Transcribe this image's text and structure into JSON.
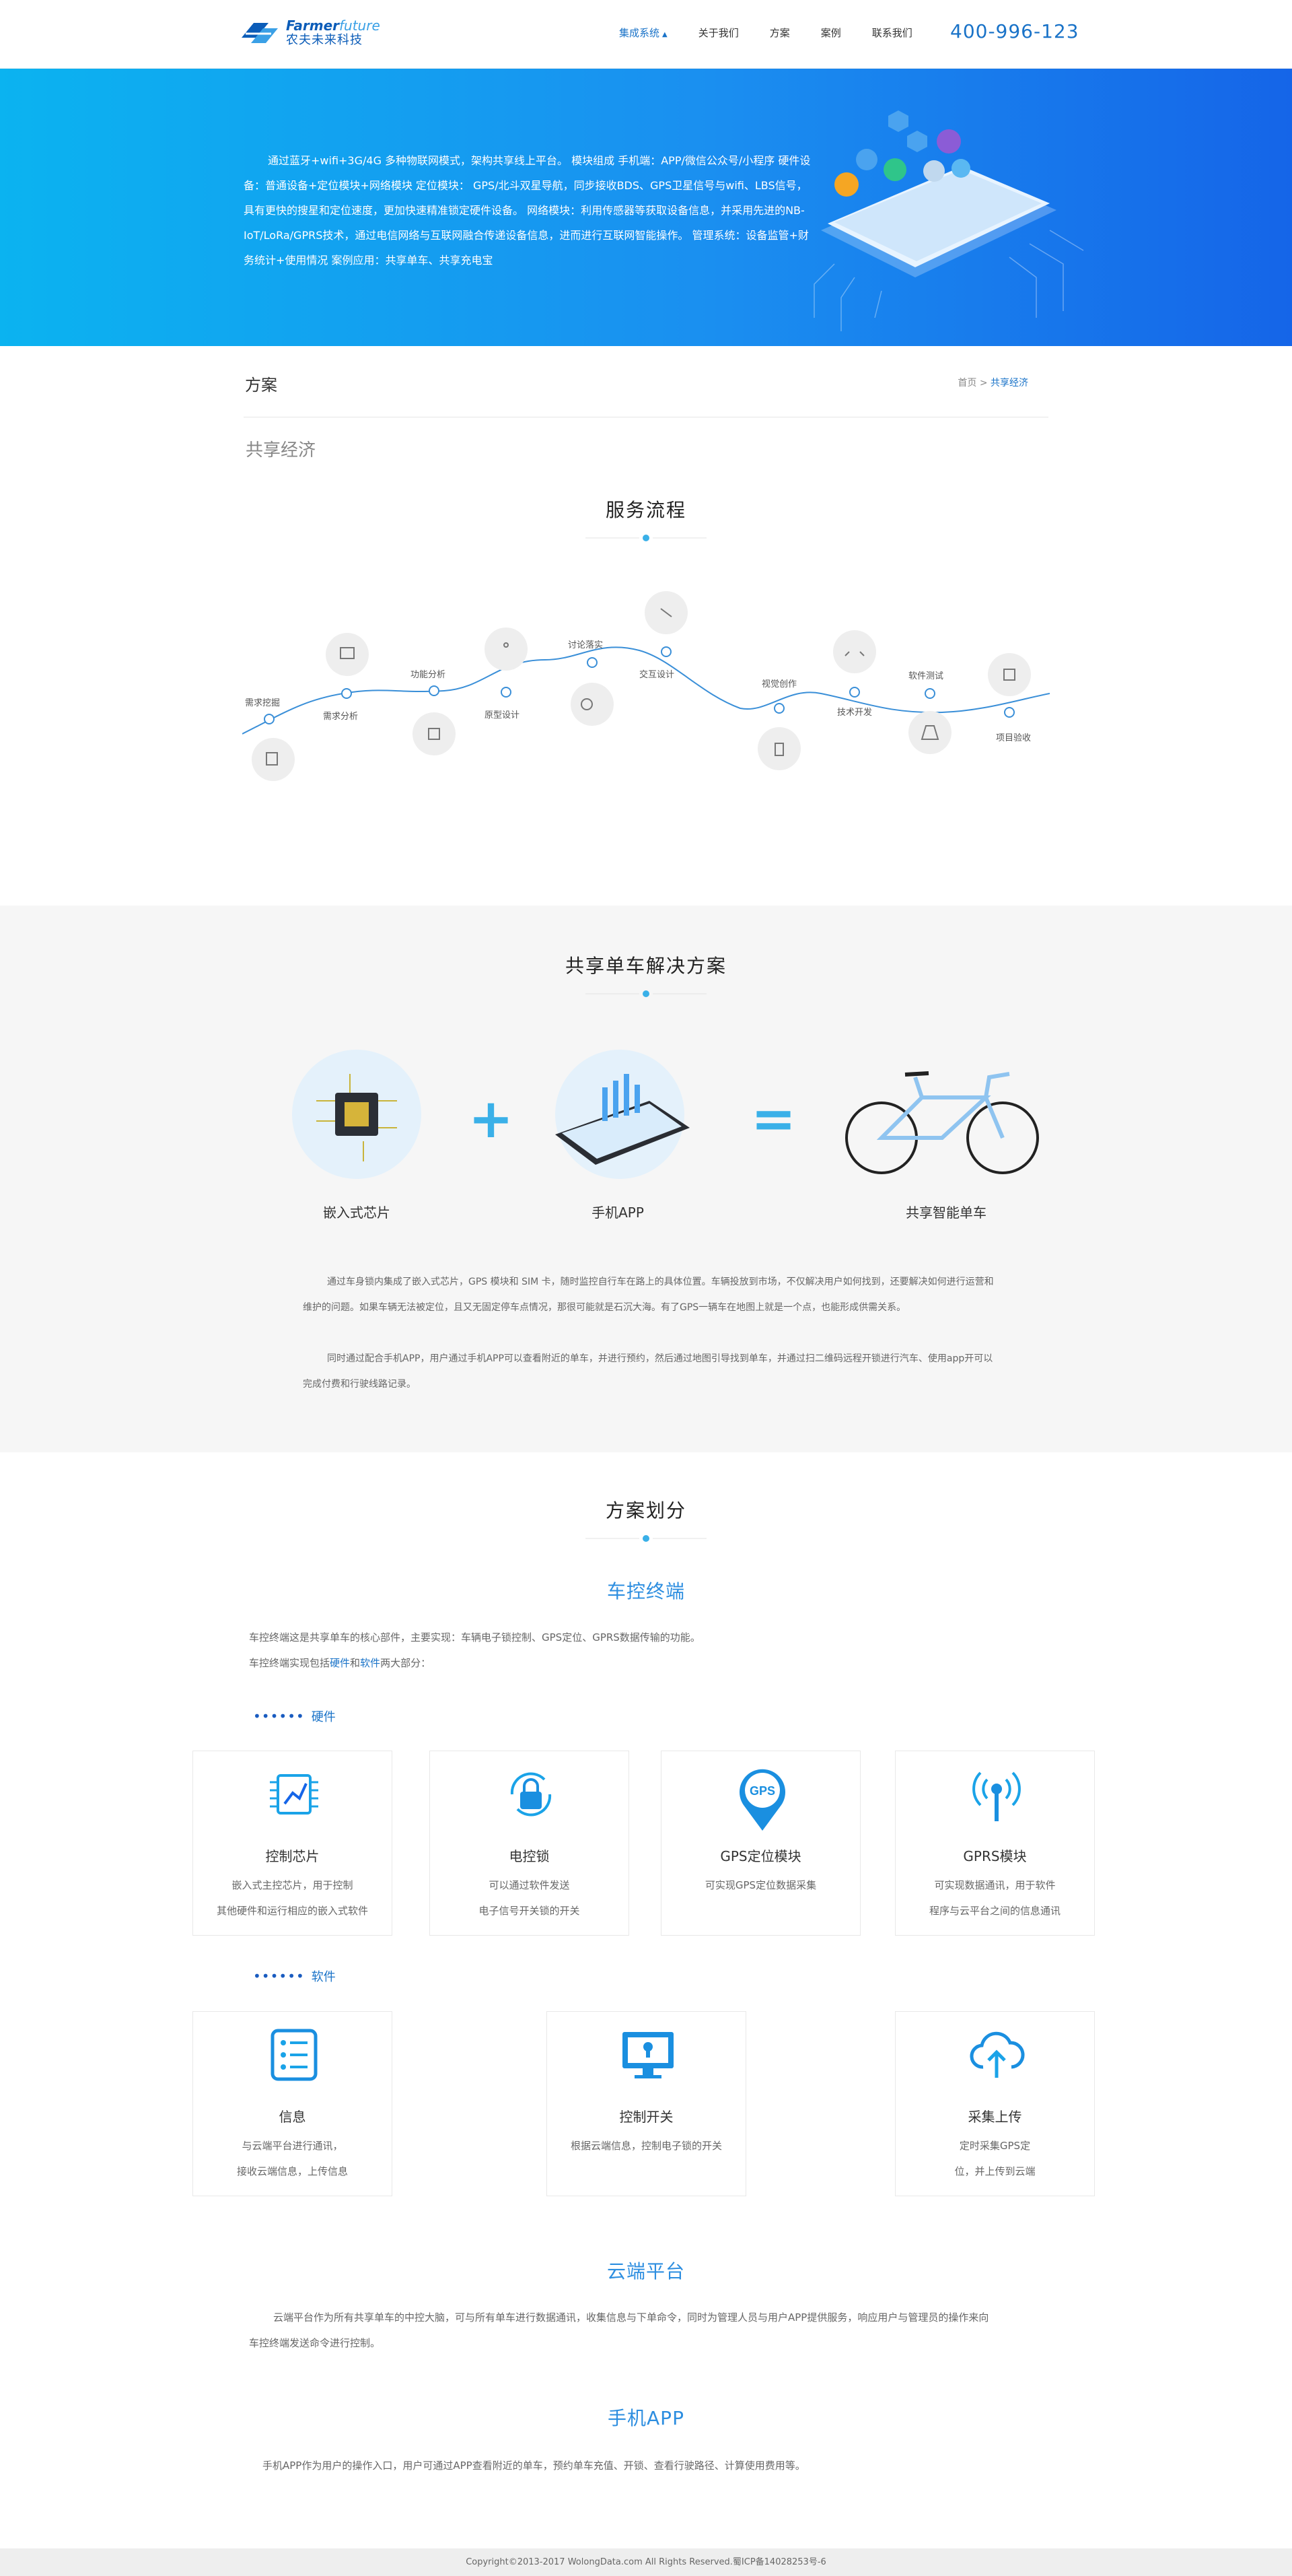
{
  "header": {
    "logo_en_a": "Farmer",
    "logo_en_b": "future",
    "logo_cn": "农夫未来科技",
    "nav": [
      {
        "label": "集成系统"
      },
      {
        "label": "关于我们"
      },
      {
        "label": "方案"
      },
      {
        "label": "案例"
      },
      {
        "label": "联系我们"
      }
    ],
    "hotline": "400-996-123"
  },
  "banner": {
    "text": "通过蓝牙+wifi+3G/4G 多种物联网模式，架构共享线上平台。 模块组成 手机端：APP/微信公众号/小程序 硬件设备：普通设备+定位模块+网络模块 定位模块： GPS/北斗双星导航，同步接收BDS、GPS卫星信号与wifi、LBS信号，具有更快的搜星和定位速度，更加快速精准锁定硬件设备。 网络模块：利用传感器等获取设备信息，并采用先进的NB-IoT/LoRa/GPRS技术，通过电信网络与互联网融合传递设备信息，进而进行互联网智能操作。 管理系统：设备监管+财务统计+使用情况 案例应用：共享单车、共享充电宝"
  },
  "breadcrumb": {
    "title": "方案",
    "home": "首页",
    "sep": ">",
    "current": "共享经济"
  },
  "subtitle": "共享经济",
  "flow": {
    "title": "服务流程",
    "steps": [
      {
        "label": "需求挖掘"
      },
      {
        "label": "需求分析"
      },
      {
        "label": "功能分析"
      },
      {
        "label": "原型设计"
      },
      {
        "label": "讨论落实"
      },
      {
        "label": "交互设计"
      },
      {
        "label": "视觉创作"
      },
      {
        "label": "技术开发"
      },
      {
        "label": "软件测试"
      },
      {
        "label": "项目验收"
      }
    ]
  },
  "solution": {
    "title": "共享单车解决方案",
    "items": [
      {
        "label": "嵌入式芯片"
      },
      {
        "label": "手机APP"
      },
      {
        "label": "共享智能单车"
      }
    ],
    "plus": "+",
    "equals": "=",
    "para1": "通过车身锁内集成了嵌入式芯片，GPS 模块和 SIM 卡，随时监控自行车在路上的具体位置。车辆投放到市场，不仅解决用户如何找到，还要解决如何进行运营和维护的问题。如果车辆无法被定位，且又无固定停车点情况，那很可能就是石沉大海。有了GPS一辆车在地图上就是一个点，也能形成供需关系。",
    "para2": "同时通过配合手机APP，用户通过手机APP可以查看附近的单车，并进行预约，然后通过地图引导找到单车，并通过扫二维码远程开锁进行汽车、使用app开可以完成付费和行驶线路记录。"
  },
  "plan": {
    "title": "方案划分",
    "terminal": {
      "title": "车控终端",
      "line1": "车控终端这是共享单车的核心部件，主要实现：车辆电子锁控制、GPS定位、GPRS数据传输的功能。",
      "line2_a": "车控终端实现包括",
      "line2_hw": "硬件",
      "line2_and": "和",
      "line2_sw": "软件",
      "line2_b": "两大部分：",
      "hw_tag": "硬件",
      "sw_tag": "软件",
      "dots": "••••••",
      "hardware": [
        {
          "title": "控制芯片",
          "desc1": "嵌入式主控芯片，用于控制",
          "desc2": "其他硬件和运行相应的嵌入式软件"
        },
        {
          "title": "电控锁",
          "desc1": "可以通过软件发送",
          "desc2": "电子信号开关锁的开关"
        },
        {
          "title": "GPS定位模块",
          "desc1": "可实现GPS定位数据采集",
          "desc2": ""
        },
        {
          "title": "GPRS模块",
          "desc1": "可实现数据通讯，用于软件",
          "desc2": "程序与云平台之间的信息通讯"
        }
      ],
      "software": [
        {
          "title": "信息",
          "desc1": "与云端平台进行通讯，",
          "desc2": "接收云端信息，上传信息"
        },
        {
          "title": "控制开关",
          "desc1": "根据云端信息，控制电子锁的开关",
          "desc2": ""
        },
        {
          "title": "采集上传",
          "desc1": "定时采集GPS定",
          "desc2": "位，并上传到云端"
        }
      ],
      "gps_badge": "GPS"
    },
    "cloud": {
      "title": "云端平台",
      "text1": "云端平台作为所有共享单车的中控大脑，可与所有单车进行数据通讯，收集信息与下单命令，同时为管理人员与用户APP提供服务，响应用户与管理员的操作来向",
      "text2": "车控终端发送命令进行控制。"
    },
    "app": {
      "title": "手机APP",
      "text": "手机APP作为用户的操作入口，用户可通过APP查看附近的单车，预约单车充值、开锁、查看行驶路径、计算使用费用等。"
    }
  },
  "footer": {
    "text": "Copyright©2013-2017 WolongData.com All Rights Reserved.蜀ICP备14028253号-6"
  },
  "colors": {
    "primary": "#1a73c8",
    "accent": "#2d8ee0",
    "banner_start": "#0bb3f0",
    "banner_end": "#1565e8"
  }
}
